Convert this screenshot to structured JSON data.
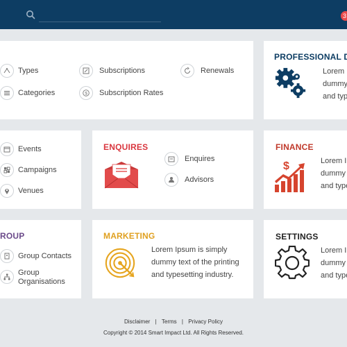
{
  "header": {
    "search_placeholder": "",
    "notification_count": "3"
  },
  "colors": {
    "header_bg": "#0d3d63",
    "enquires": "#d9363e",
    "finance": "#c0392b",
    "marketing": "#e0a020",
    "group": "#6b4a8a",
    "professional": "#0d3d63",
    "settings": "#222222"
  },
  "cards": {
    "types_card": {
      "types": "Types",
      "categories": "Categories",
      "subscriptions": "Subscriptions",
      "subscription_rates": "Subscription Rates",
      "renewals": "Renewals"
    },
    "professional": {
      "title": "PROFESSIONAL DEV",
      "desc": "Lorem dummy and typ"
    },
    "events_card": {
      "events": "Events",
      "campaigns": "Campaigns",
      "venues": "Venues"
    },
    "enquires": {
      "title": "ENQUIRES",
      "enquires_link": "Enquires",
      "advisors_link": "Advisors"
    },
    "finance": {
      "title": "FINANCE",
      "desc": "Lorem Ip dummy and type"
    },
    "group": {
      "title": "ROUP",
      "group_contacts": "Group Contacts",
      "group_organisations": "Group Organisations"
    },
    "marketing": {
      "title": "MARKETING",
      "desc": "Lorem Ipsum is simply dummy text of the printing and typesetting industry."
    },
    "settings": {
      "title": "SETTINGS",
      "desc": "Lorem Ip dummy and type"
    }
  },
  "footer": {
    "disclaimer": "Disclaimer",
    "terms": "Terms",
    "privacy": "Privacy Policy",
    "separator": "|",
    "copyright": "Copyright © 2014 Smart Impact Ltd. All Rights Reserved."
  }
}
